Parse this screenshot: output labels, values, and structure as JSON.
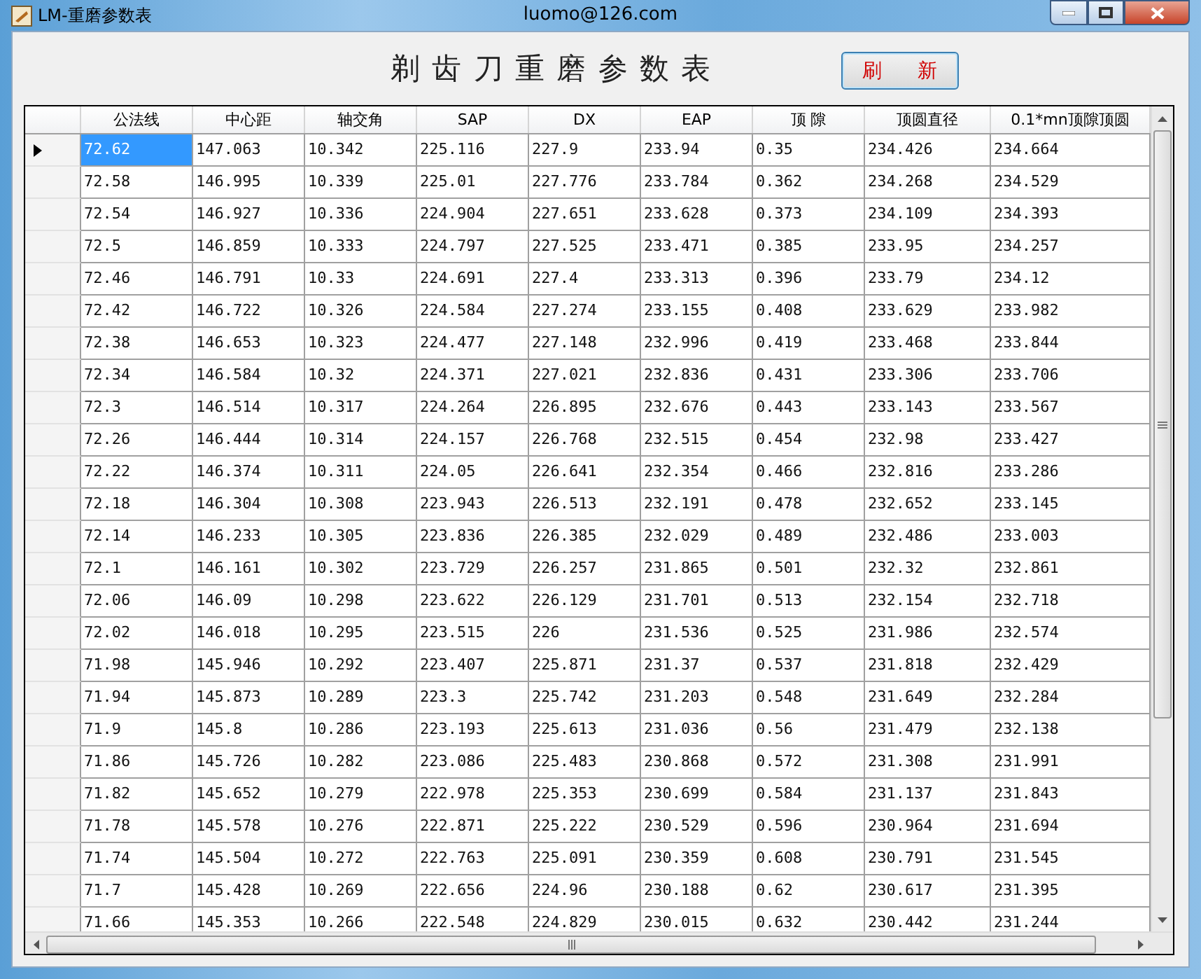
{
  "window": {
    "title": "LM-重磨参数表",
    "caption": "luomo@126.com"
  },
  "heading": "剃 齿 刀 重 磨 参 数 表",
  "refresh_button": "刷 新",
  "table": {
    "columns": [
      "公法线",
      "中心距",
      "轴交角",
      "SAP",
      "DX",
      "EAP",
      "顶 隙",
      "顶圆直径",
      "0.1*mn顶隙顶圆"
    ],
    "rows": [
      {
        "current": true,
        "cells": [
          "72.62",
          "147.063",
          "10.342",
          "225.116",
          "227.9",
          "233.94",
          "0.35",
          "234.426",
          "234.664"
        ]
      },
      {
        "current": false,
        "cells": [
          "72.58",
          "146.995",
          "10.339",
          "225.01",
          "227.776",
          "233.784",
          "0.362",
          "234.268",
          "234.529"
        ]
      },
      {
        "current": false,
        "cells": [
          "72.54",
          "146.927",
          "10.336",
          "224.904",
          "227.651",
          "233.628",
          "0.373",
          "234.109",
          "234.393"
        ]
      },
      {
        "current": false,
        "cells": [
          "72.5",
          "146.859",
          "10.333",
          "224.797",
          "227.525",
          "233.471",
          "0.385",
          "233.95",
          "234.257"
        ]
      },
      {
        "current": false,
        "cells": [
          "72.46",
          "146.791",
          "10.33",
          "224.691",
          "227.4",
          "233.313",
          "0.396",
          "233.79",
          "234.12"
        ]
      },
      {
        "current": false,
        "cells": [
          "72.42",
          "146.722",
          "10.326",
          "224.584",
          "227.274",
          "233.155",
          "0.408",
          "233.629",
          "233.982"
        ]
      },
      {
        "current": false,
        "cells": [
          "72.38",
          "146.653",
          "10.323",
          "224.477",
          "227.148",
          "232.996",
          "0.419",
          "233.468",
          "233.844"
        ]
      },
      {
        "current": false,
        "cells": [
          "72.34",
          "146.584",
          "10.32",
          "224.371",
          "227.021",
          "232.836",
          "0.431",
          "233.306",
          "233.706"
        ]
      },
      {
        "current": false,
        "cells": [
          "72.3",
          "146.514",
          "10.317",
          "224.264",
          "226.895",
          "232.676",
          "0.443",
          "233.143",
          "233.567"
        ]
      },
      {
        "current": false,
        "cells": [
          "72.26",
          "146.444",
          "10.314",
          "224.157",
          "226.768",
          "232.515",
          "0.454",
          "232.98",
          "233.427"
        ]
      },
      {
        "current": false,
        "cells": [
          "72.22",
          "146.374",
          "10.311",
          "224.05",
          "226.641",
          "232.354",
          "0.466",
          "232.816",
          "233.286"
        ]
      },
      {
        "current": false,
        "cells": [
          "72.18",
          "146.304",
          "10.308",
          "223.943",
          "226.513",
          "232.191",
          "0.478",
          "232.652",
          "233.145"
        ]
      },
      {
        "current": false,
        "cells": [
          "72.14",
          "146.233",
          "10.305",
          "223.836",
          "226.385",
          "232.029",
          "0.489",
          "232.486",
          "233.003"
        ]
      },
      {
        "current": false,
        "cells": [
          "72.1",
          "146.161",
          "10.302",
          "223.729",
          "226.257",
          "231.865",
          "0.501",
          "232.32",
          "232.861"
        ]
      },
      {
        "current": false,
        "cells": [
          "72.06",
          "146.09",
          "10.298",
          "223.622",
          "226.129",
          "231.701",
          "0.513",
          "232.154",
          "232.718"
        ]
      },
      {
        "current": false,
        "cells": [
          "72.02",
          "146.018",
          "10.295",
          "223.515",
          "226",
          "231.536",
          "0.525",
          "231.986",
          "232.574"
        ]
      },
      {
        "current": false,
        "cells": [
          "71.98",
          "145.946",
          "10.292",
          "223.407",
          "225.871",
          "231.37",
          "0.537",
          "231.818",
          "232.429"
        ]
      },
      {
        "current": false,
        "cells": [
          "71.94",
          "145.873",
          "10.289",
          "223.3",
          "225.742",
          "231.203",
          "0.548",
          "231.649",
          "232.284"
        ]
      },
      {
        "current": false,
        "cells": [
          "71.9",
          "145.8",
          "10.286",
          "223.193",
          "225.613",
          "231.036",
          "0.56",
          "231.479",
          "232.138"
        ]
      },
      {
        "current": false,
        "cells": [
          "71.86",
          "145.726",
          "10.282",
          "223.086",
          "225.483",
          "230.868",
          "0.572",
          "231.308",
          "231.991"
        ]
      },
      {
        "current": false,
        "cells": [
          "71.82",
          "145.652",
          "10.279",
          "222.978",
          "225.353",
          "230.699",
          "0.584",
          "231.137",
          "231.843"
        ]
      },
      {
        "current": false,
        "cells": [
          "71.78",
          "145.578",
          "10.276",
          "222.871",
          "225.222",
          "230.529",
          "0.596",
          "230.964",
          "231.694"
        ]
      },
      {
        "current": false,
        "cells": [
          "71.74",
          "145.504",
          "10.272",
          "222.763",
          "225.091",
          "230.359",
          "0.608",
          "230.791",
          "231.545"
        ]
      },
      {
        "current": false,
        "cells": [
          "71.7",
          "145.428",
          "10.269",
          "222.656",
          "224.96",
          "230.188",
          "0.62",
          "230.617",
          "231.395"
        ]
      },
      {
        "current": false,
        "cells": [
          "71.66",
          "145.353",
          "10.266",
          "222.548",
          "224.829",
          "230.015",
          "0.632",
          "230.442",
          "231.244"
        ]
      }
    ]
  }
}
